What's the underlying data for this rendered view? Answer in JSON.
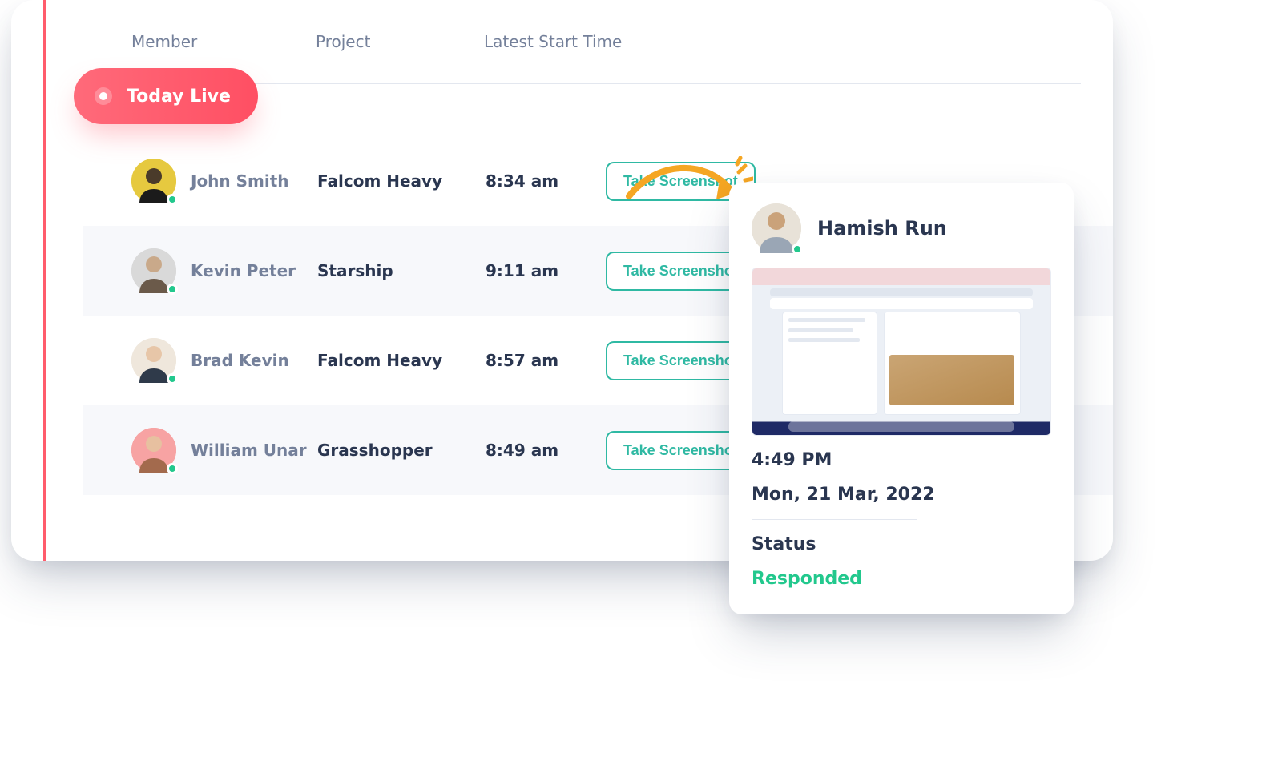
{
  "columns": {
    "member": "Member",
    "project": "Project",
    "time": "Latest Start Time"
  },
  "live_label": "Today Live",
  "action_label": "Take Screenshot",
  "rows": [
    {
      "name": "John Smith",
      "project": "Falcom Heavy",
      "time": "8:34 am",
      "avatar_bg": "#e6c93f"
    },
    {
      "name": "Kevin Peter",
      "project": "Starship",
      "time": "9:11 am",
      "avatar_bg": "#d9d9d9"
    },
    {
      "name": "Brad Kevin",
      "project": "Falcom Heavy",
      "time": "8:57 am",
      "avatar_bg": "#efe7dc"
    },
    {
      "name": "William Unar",
      "project": "Grasshopper",
      "time": "8:49 am",
      "avatar_bg": "#f7a3a3"
    }
  ],
  "popup": {
    "name": "Hamish Run",
    "time": "4:49 PM",
    "date": "Mon, 21 Mar, 2022",
    "status_label": "Status",
    "status_value": "Responded",
    "avatar_bg": "#e8e2d8"
  }
}
